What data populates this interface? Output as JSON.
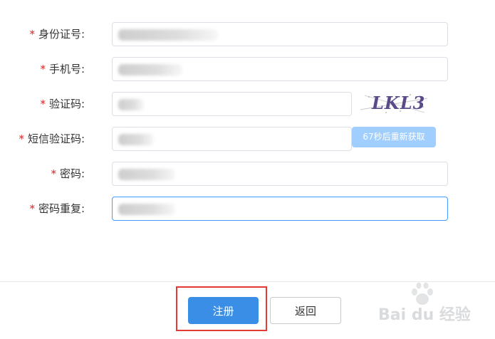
{
  "form": {
    "required_mark": "*",
    "fields": [
      {
        "label": "身份证号:",
        "value": ""
      },
      {
        "label": "手机号:",
        "value": ""
      },
      {
        "label": "验证码:",
        "value": ""
      },
      {
        "label": "短信验证码:",
        "value": ""
      },
      {
        "label": "密码:",
        "value": ""
      },
      {
        "label": "密码重复:",
        "value": ""
      }
    ],
    "captcha_text": "LKL3",
    "sms_button_label": "67秒后重新获取"
  },
  "footer": {
    "register_label": "注册",
    "back_label": "返回"
  },
  "watermark": {
    "text": "Bai du 经验",
    "icon": "baidu-paw-icon"
  },
  "colors": {
    "required": "#e02020",
    "primary": "#3a8ee6",
    "sms_button": "#a0cfff",
    "focus_border": "#409eff",
    "highlight": "#e53935"
  }
}
